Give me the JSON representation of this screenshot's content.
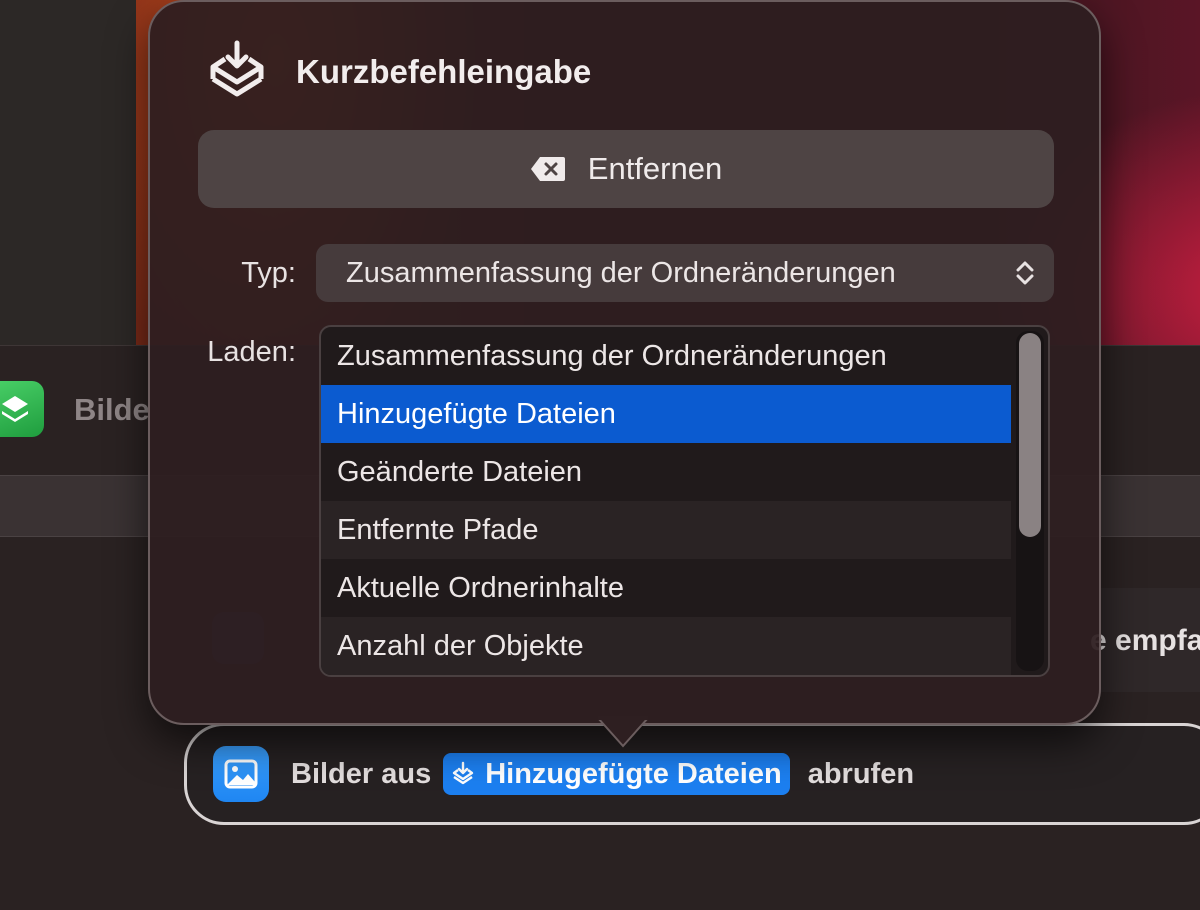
{
  "background": {
    "window_title_partial": "Bilde",
    "row_text_partial": "e empfa"
  },
  "popover": {
    "title": "Kurzbefehleingabe",
    "remove_label": "Entfernen",
    "type_label": "Typ:",
    "type_value": "Zusammenfassung der Ordneränderungen",
    "load_label": "Laden:",
    "load_options": [
      "Zusammenfassung der Ordneränderungen",
      "Hinzugefügte Dateien",
      "Geänderte Dateien",
      "Entfernte Pfade",
      "Aktuelle Ordnerinhalte",
      "Anzahl der Objekte"
    ],
    "selected_option": "Hinzugefügte Dateien"
  },
  "action": {
    "prefix": "Bilder aus",
    "token": "Hinzugefügte Dateien",
    "suffix": "abrufen"
  },
  "icons": {
    "header": "shortcut-input-icon",
    "remove": "delete-left-icon",
    "select": "chevron-up-down-icon",
    "action": "photo-icon",
    "token": "shortcut-input-icon"
  },
  "colors": {
    "selection": "#0b5bd0",
    "token": "#1c7ff0",
    "action_icon": "#1f86f2"
  }
}
